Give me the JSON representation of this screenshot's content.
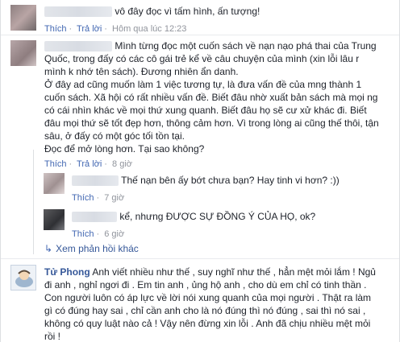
{
  "comments": [
    {
      "text": "vô đây đọc vì tấm hình, ấn tượng!",
      "actions": [
        "Thích",
        "Trả lời"
      ],
      "time": "Hôm qua lúc 12:23"
    },
    {
      "text_lines": [
        "Mình từng đọc một cuốn sách về nạn nạo phá thai của Trung",
        "Quốc, trong đấy có các cô gái trẻ kể về câu chuyện của mình (xin lỗi lâu r",
        "mình k nhớ tên sách). Đương nhiên ẩn danh.",
        "Ở đây ad cũng muốn làm 1 việc tương tự, là đưa vấn đề của mng thành 1",
        "cuốn sách. Xã hội có rất nhiều vấn đề. Biết đâu nhờ xuất bản sách mà mọi ng",
        "có cái nhìn khác về mọi thứ xung quanh. Biết đâu họ sẽ cư xử khác đi. Biết",
        "đâu mọi thứ sẽ tốt đẹp hơn, thông cảm hơn. Vì trong lòng ai cũng thế thôi, tận",
        "sâu, ở đấy có một góc tối tồn tại.",
        "Đọc để mở lòng hơn. Tại sao không?"
      ],
      "actions": [
        "Thích",
        "Trả lời"
      ],
      "time": "8 giờ"
    },
    {
      "text": "Thế nạn bên ấy bớt chưa bạn? Hay tinh vi hơn? :))",
      "actions": [
        "Thích"
      ],
      "time": "7 giờ"
    },
    {
      "text": "kể, nhưng ĐƯỢC SỰ ĐỒNG Ý CỦA HỌ, ok?",
      "actions": [
        "Thích"
      ],
      "time": "6 giờ"
    },
    {
      "name": "Tử Phong",
      "text_lines": [
        "Anh viết nhiều như thế , suy nghĩ như thế , hẳn mệt mỏi lắm ! Ngủ",
        "đi anh , nghỉ ngơi đi . Em tin anh , ủng hộ anh , cho dù em chỉ có tinh thần .",
        "Con người luôn có áp lực về lời nói xung quanh của mọi người . Thật ra làm",
        "gì có đúng hay sai , chỉ cần anh cho là nó đúng thì nó đúng , sai thì nó sai ,",
        "không có quy luật nào cả ! Vậy nên đừng xin lỗi . Anh đã chịu nhiều mệt mỏi",
        "rồi !"
      ]
    }
  ],
  "more_replies": "Xem phản hồi khác",
  "icons": {
    "more_replies_icon": "reply-arrow-icon"
  }
}
